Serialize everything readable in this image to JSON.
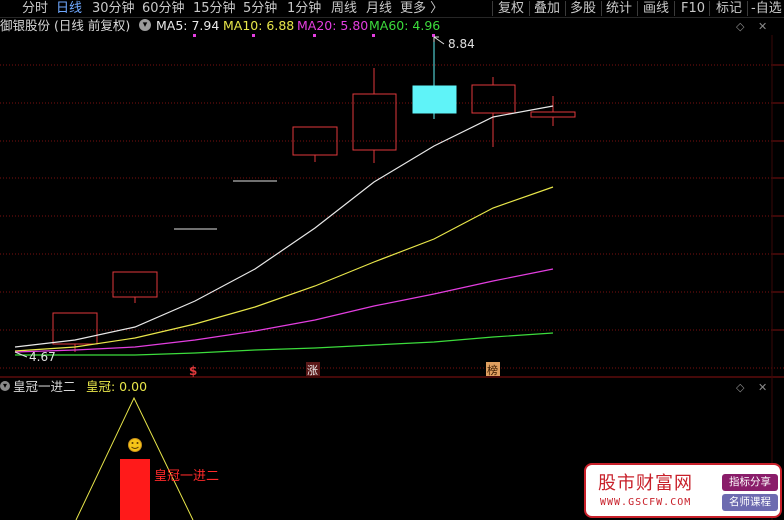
{
  "toolbar": {
    "tabs": [
      {
        "label": "分时",
        "active": false
      },
      {
        "label": "日线",
        "active": true
      },
      {
        "label": "30分钟",
        "active": false
      },
      {
        "label": "60分钟",
        "active": false
      },
      {
        "label": "15分钟",
        "active": false
      },
      {
        "label": "5分钟",
        "active": false
      },
      {
        "label": "1分钟",
        "active": false
      },
      {
        "label": "周线",
        "active": false
      },
      {
        "label": "月线",
        "active": false
      },
      {
        "label": "更多 〉",
        "active": false
      }
    ],
    "right_tabs": [
      "复权",
      "叠加",
      "多股",
      "统计",
      "画线",
      "F10",
      "标记",
      "-自选"
    ]
  },
  "legend": {
    "stock": "御银股份 (日线 前复权)",
    "ma5": "MA5: 7.94",
    "ma10": "MA10: 6.88",
    "ma20": "MA20: 5.80",
    "ma60": "MA60: 4.96"
  },
  "colors": {
    "up": "#e0393b",
    "down": "#5ff3f8",
    "ma5": "#e8e8e8",
    "ma10": "#e8e64a",
    "ma20": "#e33ee0",
    "ma60": "#3cdc3c",
    "indicator_line": "#e8e64a",
    "grid": "#7a1010"
  },
  "price_labels": {
    "high": "8.84",
    "low": "4.67"
  },
  "markers": [
    "$",
    "涨",
    "榜"
  ],
  "indicator": {
    "name": "皇冠一进二",
    "value_label": "皇冠: 0.00",
    "bar_label": "皇冠一进二"
  },
  "chart_data": {
    "type": "candlestick",
    "series": [
      {
        "name": "MA5",
        "color": "#e8e8e8"
      },
      {
        "name": "MA10",
        "color": "#e8e64a"
      },
      {
        "name": "MA20",
        "color": "#e33ee0"
      },
      {
        "name": "MA60",
        "color": "#3cdc3c"
      }
    ],
    "high": 8.84,
    "low": 4.67
  },
  "watermark": {
    "title": "股市财富网",
    "url": "WWW.GSCFW.COM",
    "badge1": "指标分享",
    "badge2": "名师课程"
  }
}
